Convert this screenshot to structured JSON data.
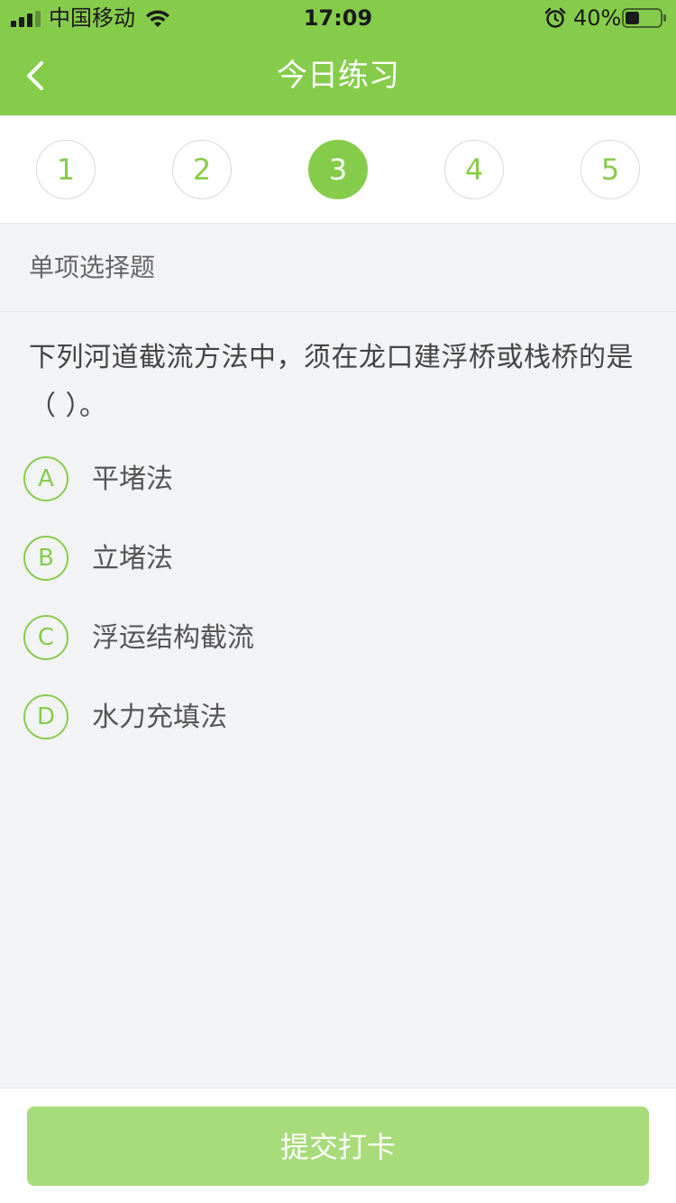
{
  "status_bar": {
    "carrier": "中国移动",
    "time": "17:09",
    "battery_percent": "40%",
    "battery_level": 0.4,
    "icons": [
      "signal-icon",
      "wifi-icon",
      "alarm-icon",
      "battery-icon"
    ]
  },
  "nav": {
    "title": "今日练习",
    "back_icon": "chevron-left-icon"
  },
  "steps": [
    {
      "label": "1",
      "active": false
    },
    {
      "label": "2",
      "active": false
    },
    {
      "label": "3",
      "active": true
    },
    {
      "label": "4",
      "active": false
    },
    {
      "label": "5",
      "active": false
    }
  ],
  "question": {
    "type_label": "单项选择题",
    "text": "下列河道截流方法中，须在龙口建浮桥或栈桥的是（ ）。",
    "options": [
      {
        "letter": "A",
        "text": "平堵法"
      },
      {
        "letter": "B",
        "text": "立堵法"
      },
      {
        "letter": "C",
        "text": "浮运结构截流"
      },
      {
        "letter": "D",
        "text": "水力充填法"
      }
    ]
  },
  "footer": {
    "submit_label": "提交打卡"
  },
  "colors": {
    "brand_green": "#86cc4b",
    "submit_disabled": "#a8dc7a",
    "background": "#f2f3f5"
  }
}
